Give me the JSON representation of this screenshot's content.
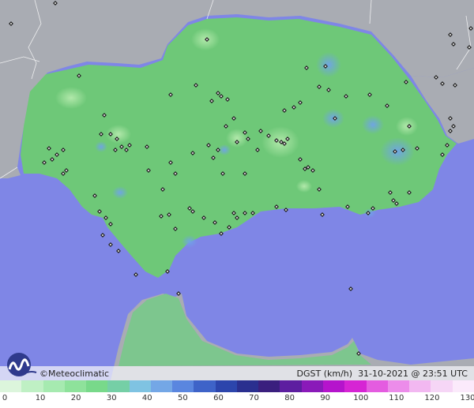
{
  "map": {
    "sea_color": "#7f86e6",
    "land_color": "#6ec878",
    "foreign_land_color": "#a9acb3",
    "station_color": "#222222"
  },
  "footer": {
    "copyright": "©Meteoclimatic",
    "parameter": "DGST (km/h)",
    "datetime": "31-10-2021 @ 23:51 UTC",
    "logo_icon": "meteoclimatic-logo-icon"
  },
  "legend": {
    "ticks": [
      "0",
      "10",
      "20",
      "30",
      "40",
      "50",
      "60",
      "70",
      "80",
      "90",
      "100",
      "110",
      "120",
      "130"
    ],
    "colors": [
      "#dcf5dc",
      "#bff0c4",
      "#a6eab0",
      "#8ee29b",
      "#78d98a",
      "#75cfa6",
      "#7fc3e2",
      "#74a7e6",
      "#5a86df",
      "#3e63c8",
      "#2c45ac",
      "#2a2f8f",
      "#3a1f7e",
      "#5d1ea0",
      "#8a1ab9",
      "#b514cc",
      "#d624d4",
      "#e45ce0",
      "#ec8cea",
      "#f2b8f1",
      "#f6d6f6",
      "#fbeafb"
    ]
  }
}
